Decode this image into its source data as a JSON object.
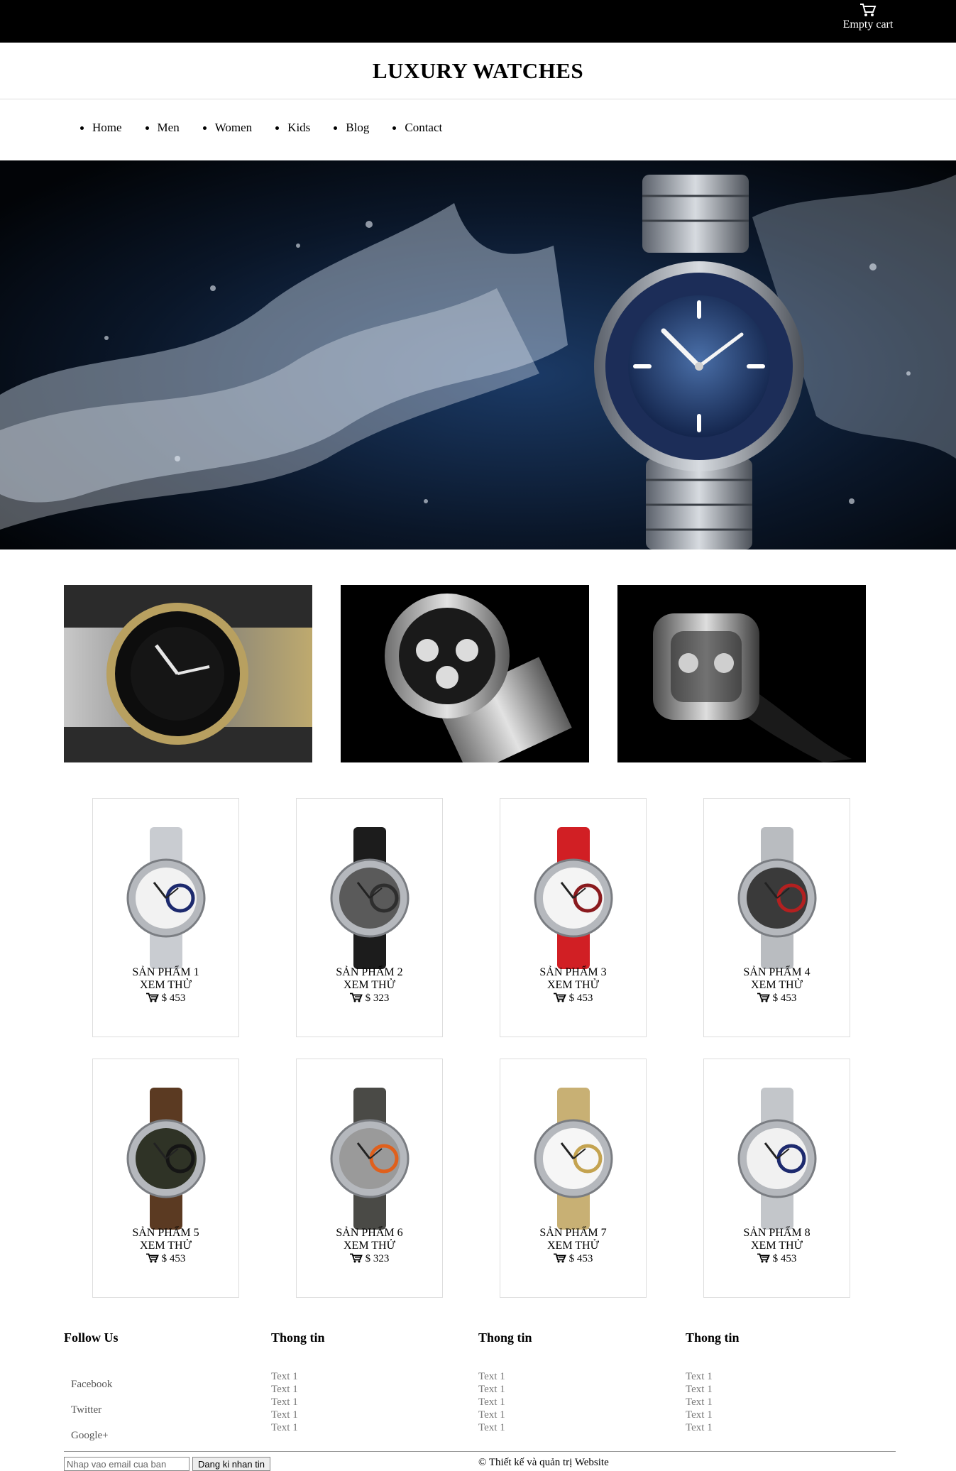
{
  "topbar": {
    "cart_label": "Empty cart"
  },
  "header": {
    "title": "LUXURY WATCHES"
  },
  "nav": {
    "items": [
      "Home",
      "Men",
      "Women",
      "Kids",
      "Blog",
      "Contact"
    ]
  },
  "products": [
    {
      "name": "SẢN PHẨM 1",
      "more": "XEM THỬ",
      "price": "$ 453",
      "strap": "#c9ccd1",
      "dial": "#f2f2f2",
      "accent": "#1d2a6e"
    },
    {
      "name": "SẢN PHẨM 2",
      "more": "XEM THỬ",
      "price": "$ 323",
      "strap": "#1c1c1c",
      "dial": "#5a5a5a",
      "accent": "#2e2e2e"
    },
    {
      "name": "SẢN PHẨM 3",
      "more": "XEM THỬ",
      "price": "$ 453",
      "strap": "#d11f24",
      "dial": "#f4f4f4",
      "accent": "#8a1a1e"
    },
    {
      "name": "SẢN PHẨM 4",
      "more": "XEM THỬ",
      "price": "$ 453",
      "strap": "#b9bcc0",
      "dial": "#3a3a3a",
      "accent": "#b32020"
    },
    {
      "name": "SẢN PHẨM 5",
      "more": "XEM THỬ",
      "price": "$ 453",
      "strap": "#5b3a22",
      "dial": "#2f3326",
      "accent": "#151515"
    },
    {
      "name": "SẢN PHẨM 6",
      "more": "XEM THỬ",
      "price": "$ 323",
      "strap": "#4a4a46",
      "dial": "#9a9a9a",
      "accent": "#e0601c"
    },
    {
      "name": "SẢN PHẨM 7",
      "more": "XEM THỬ",
      "price": "$ 453",
      "strap": "#c8b074",
      "dial": "#f6f6f6",
      "accent": "#c4a350"
    },
    {
      "name": "SẢN PHẨM 8",
      "more": "XEM THỬ",
      "price": "$ 453",
      "strap": "#c3c6ca",
      "dial": "#f1f1f1",
      "accent": "#1d2a6e"
    }
  ],
  "footer": {
    "follow_title": "Follow Us",
    "follow_links": [
      "Facebook",
      "Twitter",
      "Google+"
    ],
    "info_columns": [
      {
        "title": "Thong tin",
        "links": [
          "Text 1",
          "Text 1",
          "Text 1",
          "Text 1",
          "Text 1"
        ]
      },
      {
        "title": "Thong tin",
        "links": [
          "Text 1",
          "Text 1",
          "Text 1",
          "Text 1",
          "Text 1"
        ]
      },
      {
        "title": "Thong tin",
        "links": [
          "Text 1",
          "Text 1",
          "Text 1",
          "Text 1",
          "Text 1"
        ]
      }
    ],
    "email_placeholder": "Nhap vao email cua ban",
    "subscribe_label": "Dang ki nhan tin",
    "credits": "© Thiết kế và quản trị Website"
  }
}
